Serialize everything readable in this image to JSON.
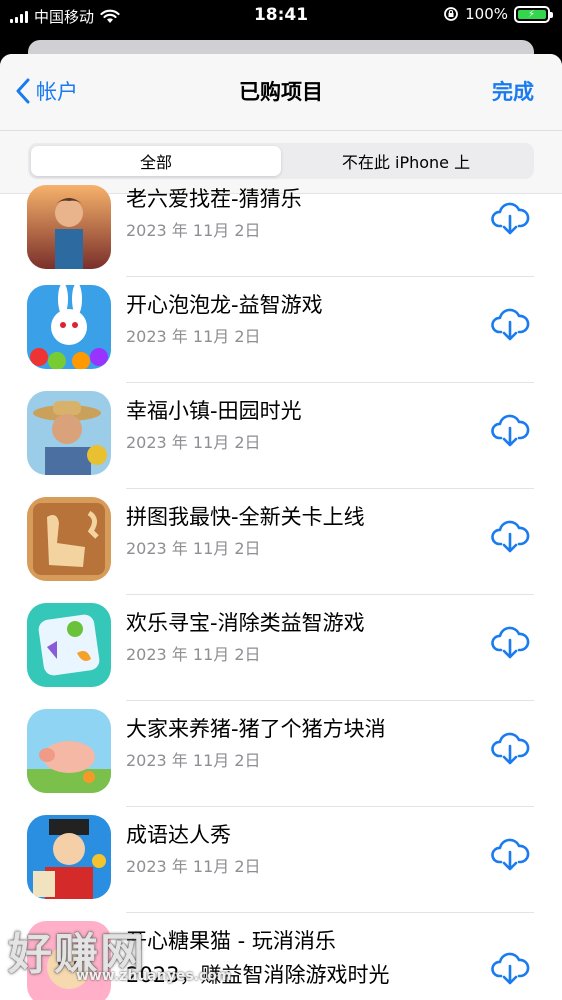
{
  "status": {
    "carrier": "中国移动",
    "time": "18:41",
    "battery": "100%"
  },
  "nav": {
    "back_label": "帐户",
    "title": "已购项目",
    "done_label": "完成"
  },
  "segments": {
    "all": "全部",
    "not_on_device": "不在此 iPhone 上"
  },
  "apps": [
    {
      "name": "老六爱找茬-猜猜乐",
      "date": "2023 年 11月 2日"
    },
    {
      "name": "开心泡泡龙-益智游戏",
      "date": "2023 年 11月 2日"
    },
    {
      "name": "幸福小镇-田园时光",
      "date": "2023 年 11月 2日"
    },
    {
      "name": "拼图我最快-全新关卡上线",
      "date": "2023 年 11月 2日"
    },
    {
      "name": "欢乐寻宝-消除类益智游戏",
      "date": "2023 年 11月 2日"
    },
    {
      "name": "大家来养猪-猪了个猪方块消",
      "date": "2023 年 11月 2日"
    },
    {
      "name": "成语达人秀",
      "date": "2023 年 11月 2日"
    },
    {
      "name": "开心糖果猫 - 玩消消乐",
      "date": "2023，赚益智消除游戏时光"
    }
  ],
  "watermark": {
    "text": "好赚网",
    "url": "www.zhuanyes.com"
  },
  "colors": {
    "accent": "#1a7bf0",
    "secondary_text": "#8e8e93"
  },
  "icons": [
    "signal-icon",
    "wifi-icon",
    "lock-rotation-icon",
    "battery-icon",
    "chevron-left-icon",
    "cloud-download-icon"
  ]
}
